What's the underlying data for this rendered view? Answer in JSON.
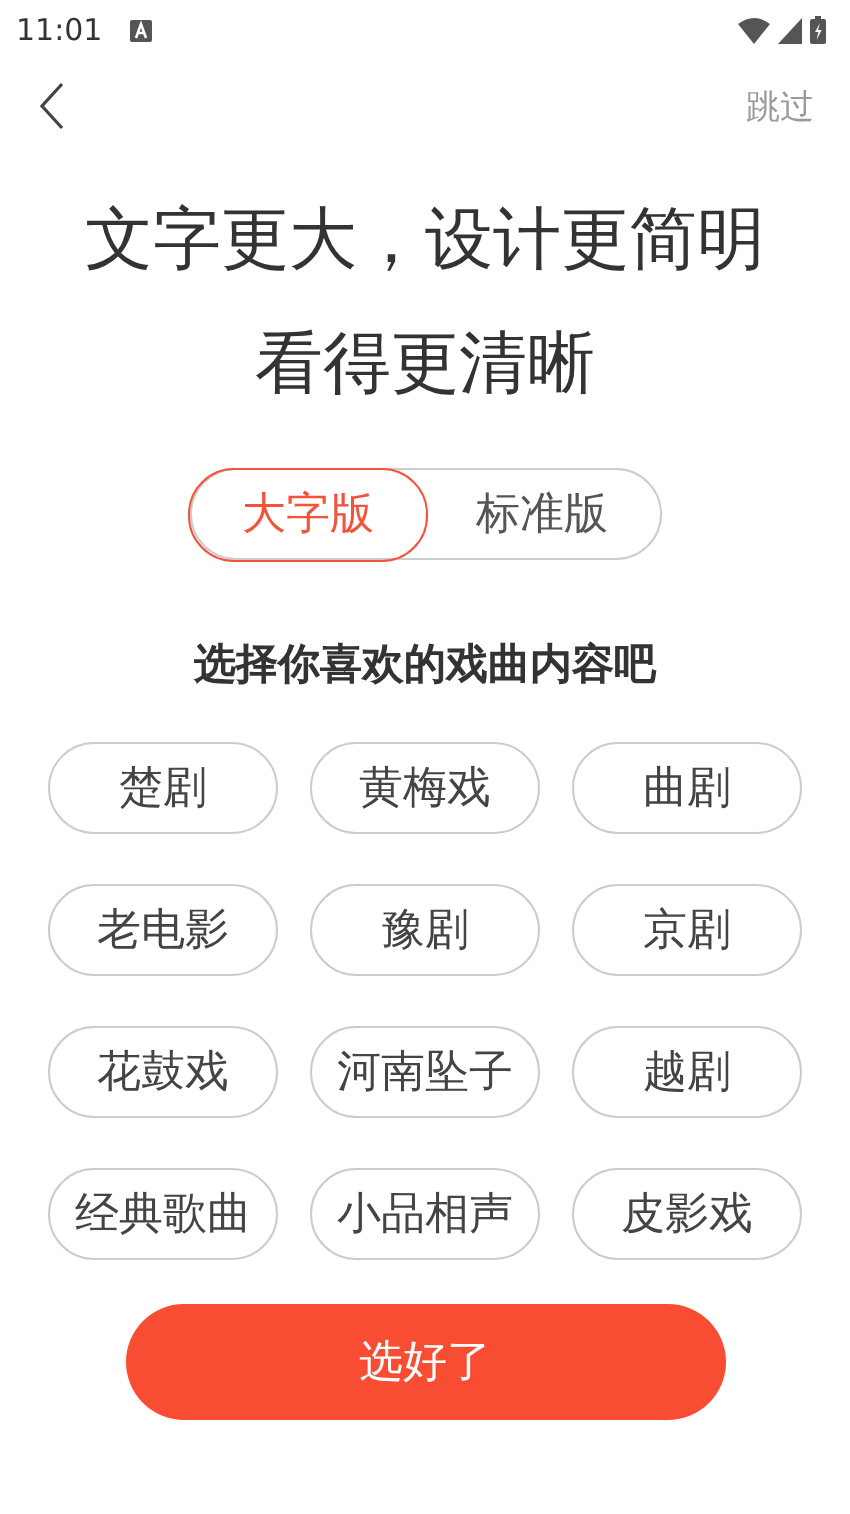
{
  "status_bar": {
    "time": "11:01"
  },
  "nav": {
    "skip": "跳过"
  },
  "headline": [
    "文字更大，设计更简明",
    "看得更清晰"
  ],
  "mode_toggle": [
    {
      "label": "大字版",
      "selected": true
    },
    {
      "label": "标准版",
      "selected": false
    }
  ],
  "prompt": "选择你喜欢的戏曲内容吧",
  "tags": [
    {
      "label": "楚剧",
      "selected": false
    },
    {
      "label": "黄梅戏",
      "selected": false
    },
    {
      "label": "曲剧",
      "selected": false
    },
    {
      "label": "老电影",
      "selected": false
    },
    {
      "label": "豫剧",
      "selected": false
    },
    {
      "label": "京剧",
      "selected": false
    },
    {
      "label": "花鼓戏",
      "selected": false
    },
    {
      "label": "河南坠子",
      "selected": false
    },
    {
      "label": "越剧",
      "selected": false
    },
    {
      "label": "经典歌曲",
      "selected": false
    },
    {
      "label": "小品相声",
      "selected": false
    },
    {
      "label": "皮影戏",
      "selected": false
    }
  ],
  "confirm_button": "选好了"
}
